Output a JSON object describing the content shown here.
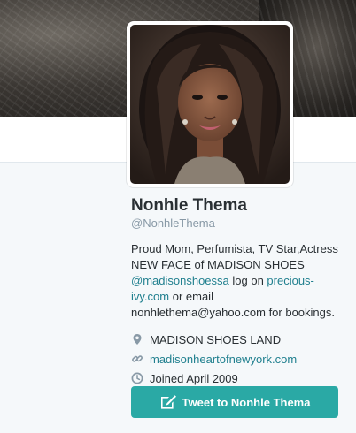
{
  "profile": {
    "name": "Nonhle Thema",
    "handle": "@NonhleThema",
    "bio": {
      "line1": "Proud Mom, Perfumista, TV Star,Actress",
      "line2": "NEW FACE of MADISON SHOES",
      "mention": "@madisonshoessa",
      "text_after_mention": " log on ",
      "link1": "precious-",
      "link1_cont": "ivy.com",
      "text_after_link": " or email",
      "line_email": "nonhlethema@yahoo.com for bookings."
    },
    "location": "MADISON SHOES LAND",
    "website": "madisonheartofnewyork.com",
    "joined": "Joined April 2009"
  },
  "actions": {
    "tweet_to_label": "Tweet to Nonhle Thema"
  },
  "icons": {
    "location": "location-pin-icon",
    "website": "link-icon",
    "joined": "calendar-clock-icon",
    "tweet": "compose-icon"
  },
  "colors": {
    "link": "#1f7f8e",
    "button": "#2aa9a5",
    "background": "#f5f8fa"
  }
}
